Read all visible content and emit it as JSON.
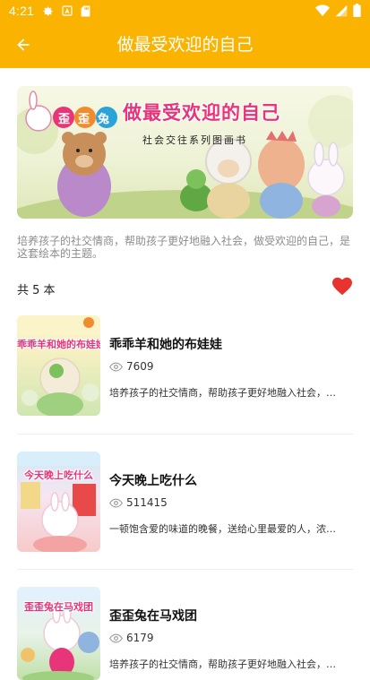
{
  "status_bar": {
    "time": "4:21",
    "icons": [
      "gear-icon",
      "text-a-icon",
      "sd-card-icon",
      "wifi-icon",
      "signal-icon",
      "battery-icon"
    ]
  },
  "app_bar": {
    "title": "做最受欢迎的自己",
    "back_icon": "arrow-left-icon"
  },
  "banner": {
    "title": "做最受欢迎的自己",
    "subtitle": "社会交往系列图画书",
    "logo_text": "歪歪兔"
  },
  "intro": "培养孩子的社交情商，帮助孩子更好地融入社会，做受欢迎的自己，是这套绘本的主题。",
  "count_label": "共 5 本",
  "favorite": {
    "icon": "heart-icon",
    "color": "#E8342F"
  },
  "books": [
    {
      "title": "乖乖羊和她的布娃娃",
      "cover_text": "乖乖羊和她的布娃娃",
      "views": "7609",
      "desc": "培养孩子的社交情商，帮助孩子更好地融入社会，…"
    },
    {
      "title": "今天晚上吃什么",
      "cover_text": "今天晚上吃什么",
      "views": "511415",
      "desc": "一顿饱含爱的味道的晚餐，送给心里最爱的人，浓…"
    },
    {
      "title": "歪歪兔在马戏团",
      "cover_text": "歪歪兔在马戏团",
      "views": "6179",
      "desc": "培养孩子的社交情商，帮助孩子更好地融入社会，…"
    }
  ],
  "colors": {
    "accent": "#F9B300",
    "heart": "#E8342F",
    "muted_text": "#8C8C8C"
  }
}
